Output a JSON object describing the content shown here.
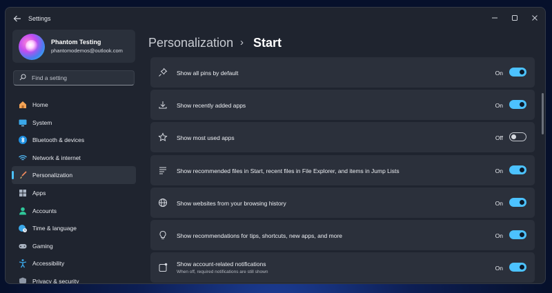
{
  "window": {
    "title": "Settings"
  },
  "profile": {
    "name": "Phantom Testing",
    "email": "phantomodemos@outlook.com"
  },
  "search": {
    "placeholder": "Find a setting"
  },
  "nav": [
    {
      "label": "Home",
      "icon": "home-icon"
    },
    {
      "label": "System",
      "icon": "system-icon"
    },
    {
      "label": "Bluetooth & devices",
      "icon": "bluetooth-icon"
    },
    {
      "label": "Network & internet",
      "icon": "wifi-icon"
    },
    {
      "label": "Personalization",
      "icon": "brush-icon",
      "active": true
    },
    {
      "label": "Apps",
      "icon": "apps-icon"
    },
    {
      "label": "Accounts",
      "icon": "accounts-icon"
    },
    {
      "label": "Time & language",
      "icon": "globe-clock-icon"
    },
    {
      "label": "Gaming",
      "icon": "gamepad-icon"
    },
    {
      "label": "Accessibility",
      "icon": "accessibility-icon"
    },
    {
      "label": "Privacy & security",
      "icon": "shield-icon"
    }
  ],
  "breadcrumb": {
    "parent": "Personalization",
    "separator": "›",
    "current": "Start"
  },
  "settings": [
    {
      "label": "Show all pins by default",
      "state": "On",
      "icon": "pin-icon"
    },
    {
      "label": "Show recently added apps",
      "state": "On",
      "icon": "download-icon"
    },
    {
      "label": "Show most used apps",
      "state": "Off",
      "icon": "star-icon"
    },
    {
      "label": "Show recommended files in Start, recent files in File Explorer, and items in Jump Lists",
      "state": "On",
      "icon": "list-icon"
    },
    {
      "label": "Show websites from your browsing history",
      "state": "On",
      "icon": "globe-icon"
    },
    {
      "label": "Show recommendations for tips, shortcuts, new apps, and more",
      "state": "On",
      "icon": "lightbulb-icon"
    },
    {
      "label": "Show account-related notifications",
      "sublabel": "When off, required notifications are still shown",
      "state": "On",
      "icon": "notification-icon"
    }
  ],
  "colors": {
    "accent": "#4cc2ff",
    "window_bg": "#1f242f",
    "card_bg": "#2b303b"
  }
}
